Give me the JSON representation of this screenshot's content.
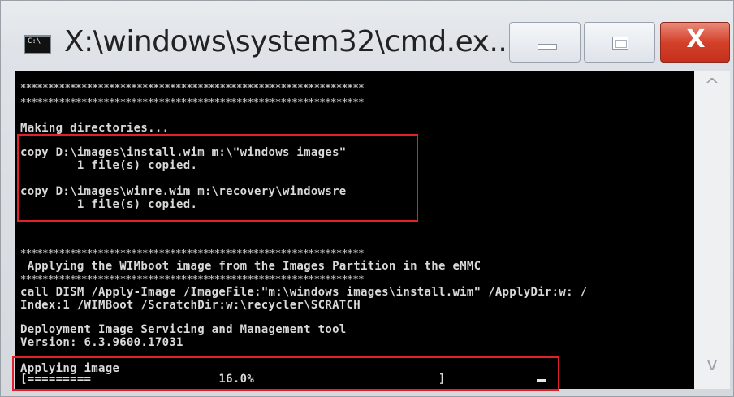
{
  "window": {
    "title": "X:\\windows\\system32\\cmd.ex...",
    "icon": "cmd-icon",
    "icon_text": "C:\\",
    "close_glyph": "X"
  },
  "scrollbar": {
    "up": "^",
    "down": "v"
  },
  "console": {
    "stars": "**************************************************************",
    "making_dirs": "Making directories...",
    "copy1_cmd": "copy D:\\images\\install.wim m:\\\"windows images\"",
    "copy1_result": "        1 file(s) copied.",
    "copy2_cmd": "copy D:\\images\\winre.wim m:\\recovery\\windowsre",
    "copy2_result": "        1 file(s) copied.",
    "applying_header": " Applying the WIMboot image from the Images Partition in the eMMC",
    "dism_line1": "call DISM /Apply-Image /ImageFile:\"m:\\windows images\\install.wim\" /ApplyDir:w: /",
    "dism_line2": "Index:1 /WIMBoot /ScratchDir:w:\\recycler\\SCRATCH",
    "tool_name": "Deployment Image Servicing and Management tool",
    "version": "Version: 6.3.9600.17031",
    "applying_image": "Applying image",
    "progress_line": "[=========                  16.0%                          ]",
    "progress": 0.16
  },
  "colors": {
    "console_bg": "#000000",
    "console_text": "#d9d9d9",
    "highlight": "#e0202a",
    "close_button": "#d4412b"
  }
}
